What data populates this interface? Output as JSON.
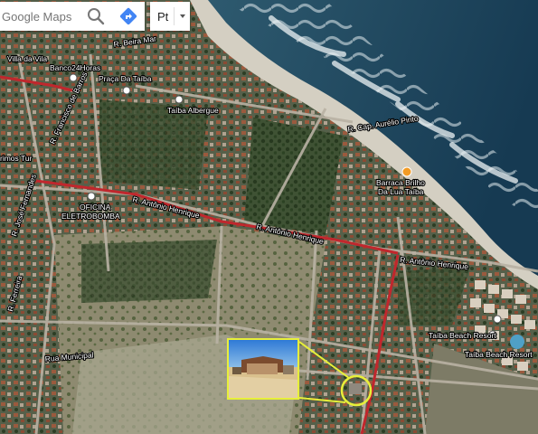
{
  "app": {
    "name": "Google Maps"
  },
  "search": {
    "placeholder": "Google Maps"
  },
  "language": {
    "selected": "Pt"
  },
  "icons": {
    "search": "search-icon",
    "directions": "directions-icon",
    "caret": "chevron-down-icon"
  },
  "colors": {
    "highlight": "#e7ef3a",
    "road_red": "#c0272d",
    "label_text": "#ffffff"
  },
  "map": {
    "streets": {
      "r_beira_mar": "R. Beira Mar",
      "r_francisco_barros": "R. Francisco de Barros",
      "r_jose_fernandes": "R. José Fernandes",
      "r_ferreira": "R. Ferreira",
      "r_antonio_henrique_1": "R. Antônio Henrique",
      "r_antonio_henrique_2": "R. Antônio Henrique",
      "r_antonio_henrique_3": "R. Antônio Henrique",
      "r_cap_aurelio_pinto": "R. Cap. Aurélio Pinto",
      "rua_municipal": "Rua Municipal"
    },
    "places": {
      "vila_da_vila": "Villa da Vila",
      "banco24horas": "Banco24Horas",
      "praca_da_taiba": "Praça Da Taíba",
      "taiba_albergue": "Taíba Albergue",
      "barraca_line1": "Barraca Brilho",
      "barraca_line2": "Da Lua Taíba",
      "oficina_line1": "OFICINA",
      "oficina_line2": "ELETROBOMBA",
      "primos_tur": "rimos Tur",
      "taiba_beach_resort_1": "Taíba Beach Resort",
      "taiba_beach_resort_2": "Taíba Beach Resort"
    }
  }
}
